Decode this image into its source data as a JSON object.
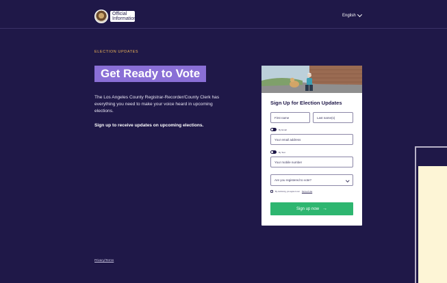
{
  "header": {
    "logo_line1": "Official",
    "logo_line2": "Information",
    "language": "English"
  },
  "hero": {
    "eyebrow": "ELECTION UPDATES",
    "title": "Get Ready to Vote",
    "description": "The Los Angeles County Registrar-Recorder/County Clerk has everything you need to make your voice heard in upcoming elections.",
    "cta_text": "Sign up to receive updates on upcoming elections."
  },
  "form": {
    "title": "Sign Up for Election Updates",
    "first_name_placeholder": "First name",
    "last_name_placeholder": "Last name(s)",
    "email_toggle_label": "By Email",
    "email_placeholder": "Your email address",
    "text_toggle_label": "By Text",
    "mobile_placeholder": "Your mobile number",
    "registered_select": "Are you registered to vote?",
    "consent_prefix": "By continuing, you agree to our",
    "consent_link": "Terms of Use",
    "submit_label": "Sign up now"
  },
  "footer": {
    "link": "Privacy/Terms"
  },
  "colors": {
    "background": "#1f1848",
    "accent_purple": "#8a6fd6",
    "eyebrow_gold": "#f0b558",
    "submit_green": "#2eb670"
  },
  "icons": {
    "language_chevron": "chevron-down-icon",
    "submit_arrow": "arrow-right-icon",
    "select_chevron": "chevron-down-icon"
  }
}
